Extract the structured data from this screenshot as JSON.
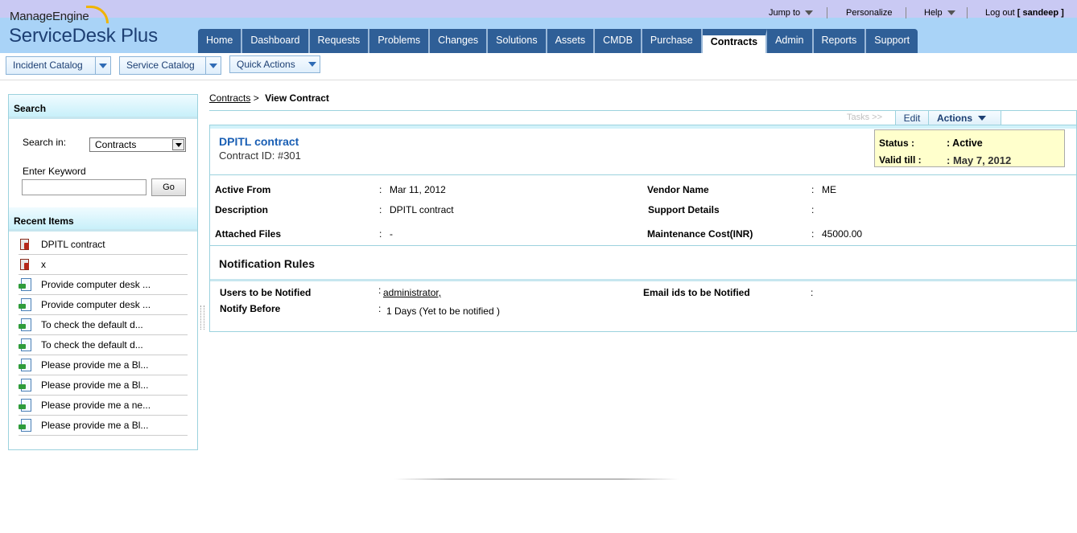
{
  "brand": {
    "company": "ManageEngine",
    "product": "ServiceDesk Plus"
  },
  "topbar": {
    "jump_to": "Jump to",
    "personalize": "Personalize",
    "help": "Help",
    "logout": "Log out",
    "user": "[ sandeep ]"
  },
  "nav": {
    "tabs": [
      "Home",
      "Dashboard",
      "Requests",
      "Problems",
      "Changes",
      "Solutions",
      "Assets",
      "CMDB",
      "Purchase",
      "Contracts",
      "Admin",
      "Reports",
      "Support"
    ],
    "active": "Contracts"
  },
  "catalog_bar": {
    "incident_catalog": "Incident Catalog",
    "service_catalog": "Service Catalog",
    "quick_actions": "Quick Actions"
  },
  "search": {
    "title": "Search",
    "search_in_label": "Search in:",
    "search_in_value": "Contracts",
    "keyword_label": "Enter Keyword",
    "go": "Go"
  },
  "recent": {
    "title": "Recent Items",
    "items": [
      {
        "label": "DPITL contract",
        "icon": "contract-icon"
      },
      {
        "label": "x",
        "icon": "contract-icon"
      },
      {
        "label": "Provide computer desk ...",
        "icon": "request-icon"
      },
      {
        "label": "Provide computer desk ...",
        "icon": "request-icon"
      },
      {
        "label": "To check the default d...",
        "icon": "request-icon"
      },
      {
        "label": "To check the default d...",
        "icon": "request-icon"
      },
      {
        "label": "Please provide me a Bl...",
        "icon": "request-icon"
      },
      {
        "label": "Please provide me a Bl...",
        "icon": "request-icon"
      },
      {
        "label": "Please provide me a ne...",
        "icon": "request-icon"
      },
      {
        "label": "Please provide me a Bl...",
        "icon": "request-icon"
      }
    ]
  },
  "breadcrumb": {
    "parent": "Contracts",
    "separator": ">",
    "current": "View Contract"
  },
  "toolbar": {
    "tasks": "Tasks >>",
    "edit": "Edit",
    "actions": "Actions"
  },
  "contract": {
    "name": "DPITL contract",
    "id_label": "Contract ID: #301",
    "status_label": "Status :",
    "status_value": ": Active",
    "valid_label": "Valid till :",
    "valid_value": ": May 7, 2012",
    "details": {
      "active_from_label": "Active From",
      "active_from_value": "Mar 11, 2012",
      "vendor_label": "Vendor Name",
      "vendor_value": "ME",
      "description_label": "Description",
      "description_value": "DPITL contract",
      "support_label": "Support Details",
      "support_value": "",
      "files_label": "Attached Files",
      "files_value": "-",
      "cost_label": "Maintenance Cost(INR)",
      "cost_value": "45000.00"
    }
  },
  "notification": {
    "title": "Notification Rules",
    "users_label": "Users to be Notified",
    "users_value": "administrator,",
    "emails_label": "Email ids to be Notified",
    "emails_value": "",
    "notify_before_label": "Notify Before",
    "notify_before_value": "1 Days (Yet to be notified )"
  }
}
